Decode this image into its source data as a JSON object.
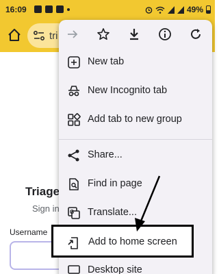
{
  "status_bar": {
    "time": "16:09",
    "battery": "49%"
  },
  "toolbar": {
    "url_text": "tri"
  },
  "page": {
    "title": "Triage",
    "subtitle": "Sign in",
    "username_label": "Username"
  },
  "menu": {
    "top_icons": [
      "forward-icon",
      "star-icon",
      "download-icon",
      "info-icon",
      "refresh-icon"
    ],
    "items": [
      {
        "label": "New tab",
        "icon": "plus-box-icon"
      },
      {
        "label": "New Incognito tab",
        "icon": "incognito-icon"
      },
      {
        "label": "Add tab to new group",
        "icon": "tab-group-icon"
      },
      {
        "label": "Share...",
        "icon": "share-icon"
      },
      {
        "label": "Find in page",
        "icon": "find-in-page-icon"
      },
      {
        "label": "Translate...",
        "icon": "translate-icon"
      },
      {
        "label": "Add to home screen",
        "icon": "add-to-home-icon"
      },
      {
        "label": "Desktop site",
        "icon": "desktop-icon"
      }
    ]
  },
  "colors": {
    "toolbar": "#f2c830",
    "omnibox": "#fbe49a",
    "menu_bg": "#f3f1f6",
    "highlight_border": "#000000"
  }
}
